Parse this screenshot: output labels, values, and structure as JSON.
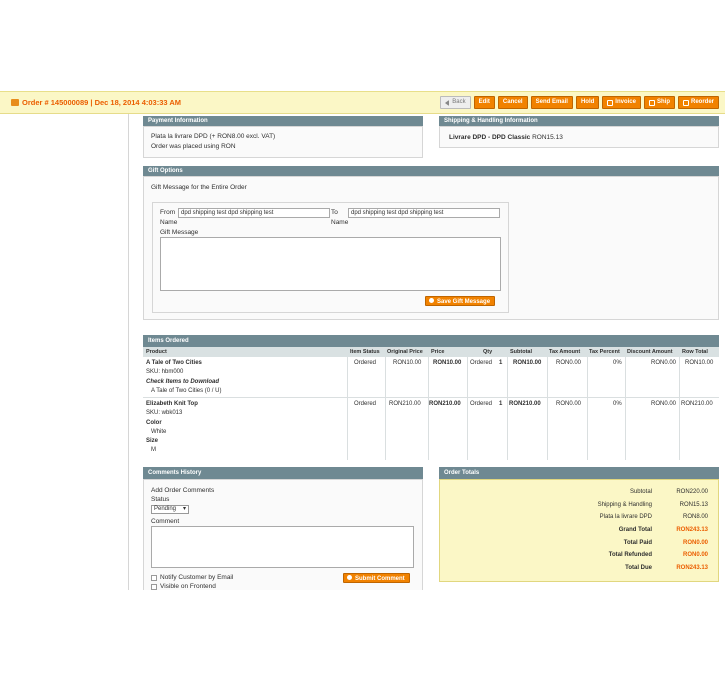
{
  "header": {
    "title": "Order # 145000089 | Dec 18, 2014 4:03:33 AM",
    "buttons": {
      "back": "Back",
      "edit": "Edit",
      "cancel": "Cancel",
      "send_email": "Send Email",
      "hold": "Hold",
      "invoice": "Invoice",
      "ship": "Ship",
      "reorder": "Reorder"
    }
  },
  "payment": {
    "heading": "Payment Information",
    "line1": "Plata la livrare DPD (+ RON8.00 excl. VAT)",
    "line2": "Order was placed using RON"
  },
  "shipping": {
    "heading": "Shipping & Handling Information",
    "method": "Livrare DPD - DPD Classic",
    "price": "RON15.13"
  },
  "gift": {
    "heading": "Gift Options",
    "subheading": "Gift Message for the Entire Order",
    "from_label": "From",
    "from_label2": "Name",
    "from_value": "dpd shipping test dpd shipping test",
    "to_label": "To",
    "to_label2": "Name",
    "to_value": "dpd shipping test dpd shipping test",
    "message_label": "Gift Message",
    "save_button": "Save Gift Message"
  },
  "items": {
    "heading": "Items Ordered",
    "columns": [
      "Product",
      "Item Status",
      "Original Price",
      "Price",
      "Qty",
      "Subtotal",
      "Tax Amount",
      "Tax Percent",
      "Discount Amount",
      "Row Total"
    ],
    "rows": [
      {
        "name": "A Tale of Two Cities",
        "sku": "SKU: hbm000",
        "extra1": "Check Items to Download",
        "extra2": "A Tale of Two Cities (0 / U)",
        "status": "Ordered",
        "original_price": "RON10.00",
        "price": "RON10.00",
        "qty_label": "Ordered",
        "qty": "1",
        "subtotal": "RON10.00",
        "tax_amount": "RON0.00",
        "tax_percent": "0%",
        "discount": "RON0.00",
        "row_total": "RON10.00"
      },
      {
        "name": "Elizabeth Knit Top",
        "sku": "SKU: wbk013",
        "extra1": "Color",
        "extra2": "White",
        "extra3": "Size",
        "extra4": "M",
        "status": "Ordered",
        "original_price": "RON210.00",
        "price": "RON210.00",
        "qty_label": "Ordered",
        "qty": "1",
        "subtotal": "RON210.00",
        "tax_amount": "RON0.00",
        "tax_percent": "0%",
        "discount": "RON0.00",
        "row_total": "RON210.00"
      }
    ]
  },
  "comments": {
    "heading": "Comments History",
    "add_label": "Add Order Comments",
    "status_label": "Status",
    "status_value": "Pending",
    "comment_label": "Comment",
    "notify_label": "Notify Customer by Email",
    "visible_label": "Visible on Frontend",
    "submit_button": "Submit Comment"
  },
  "totals": {
    "heading": "Order Totals",
    "lines": [
      {
        "label": "Subtotal",
        "value": "RON220.00"
      },
      {
        "label": "Shipping & Handling",
        "value": "RON15.13"
      },
      {
        "label": "Plata la livrare DPD",
        "value": "RON8.00"
      },
      {
        "label": "Grand Total",
        "value": "RON243.13"
      },
      {
        "label": "Total Paid",
        "value": "RON0.00"
      },
      {
        "label": "Total Refunded",
        "value": "RON0.00"
      },
      {
        "label": "Total Due",
        "value": "RON243.13"
      }
    ]
  }
}
